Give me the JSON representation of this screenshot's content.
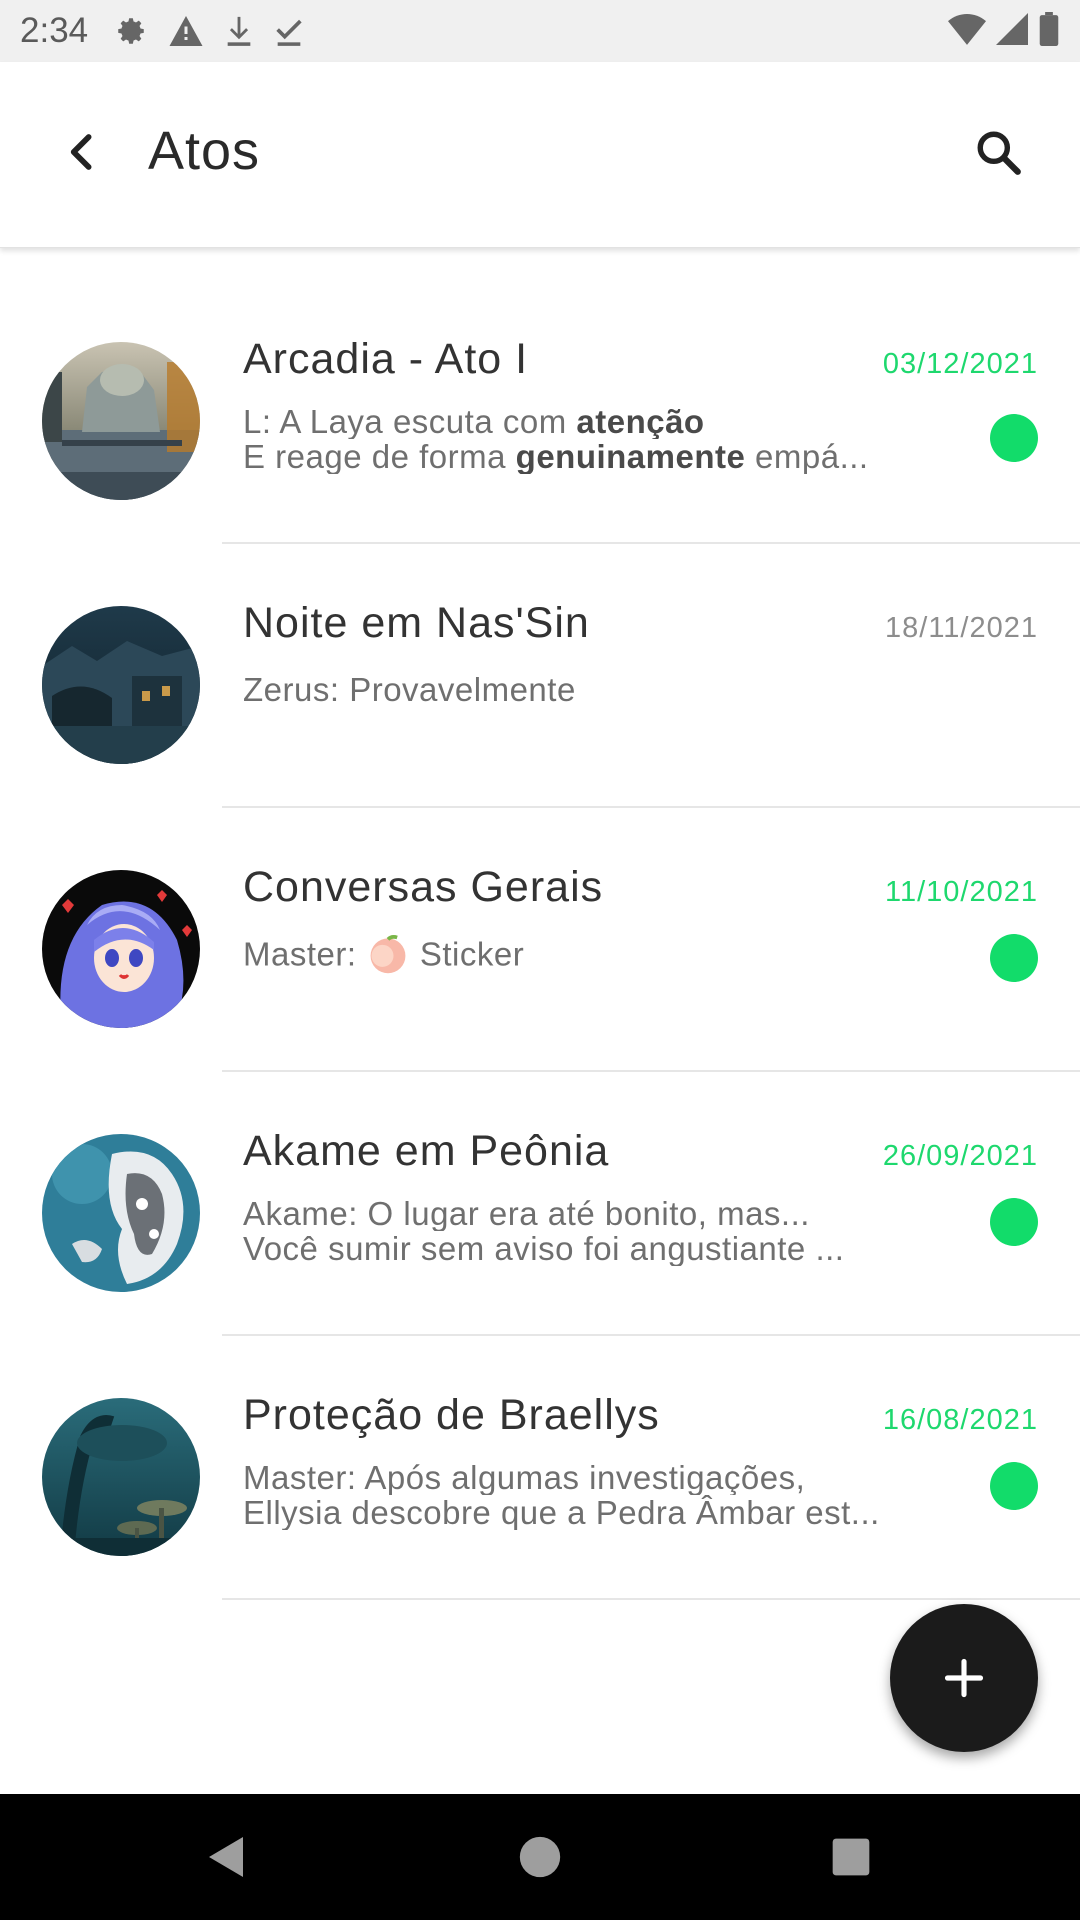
{
  "status_bar": {
    "time": "2:34",
    "icons": [
      "gear-icon",
      "warning-icon",
      "download-icon",
      "check-download-icon"
    ],
    "right_icons": [
      "wifi-icon",
      "signal-icon",
      "battery-icon"
    ]
  },
  "app_bar": {
    "title": "Atos",
    "back_icon": "back-arrow-icon",
    "search_icon": "search-icon"
  },
  "chats": [
    {
      "title": "Arcadia - Ato I",
      "date": "03/12/2021",
      "unread": true,
      "preview_line1_parts": [
        "L: A Laya escuta com ",
        "atenção",
        ""
      ],
      "preview_line2_parts": [
        "E reage de forma ",
        "genuinamente",
        " empá..."
      ]
    },
    {
      "title": "Noite em Nas'Sin",
      "date": "18/11/2021",
      "unread": false,
      "preview_line1": "Zerus: Provavelmente"
    },
    {
      "title": "Conversas Gerais",
      "date": "11/10/2021",
      "unread": true,
      "preview_line1_before": "Master: ",
      "preview_line1_after": " Sticker",
      "sticker_icon": "peach-emoji-icon"
    },
    {
      "title": "Akame em Peônia",
      "date": "26/09/2021",
      "unread": true,
      "preview_line1": "Akame: O lugar era até bonito, mas...",
      "preview_line2": "Você sumir sem aviso foi angustiante ..."
    },
    {
      "title": "Proteção de Braellys",
      "date": "16/08/2021",
      "unread": true,
      "preview_line1": "Master: Após algumas investigações,",
      "preview_line2": "Ellysia descobre que a Pedra Âmbar est..."
    }
  ],
  "fab": {
    "icon": "plus-icon"
  },
  "nav_bar": {
    "icons": [
      "nav-back-icon",
      "nav-home-icon",
      "nav-recents-icon"
    ]
  },
  "colors": {
    "unread_accent": "#12dc6a",
    "fab_bg": "#1b1b1b",
    "title_text": "#333333"
  }
}
